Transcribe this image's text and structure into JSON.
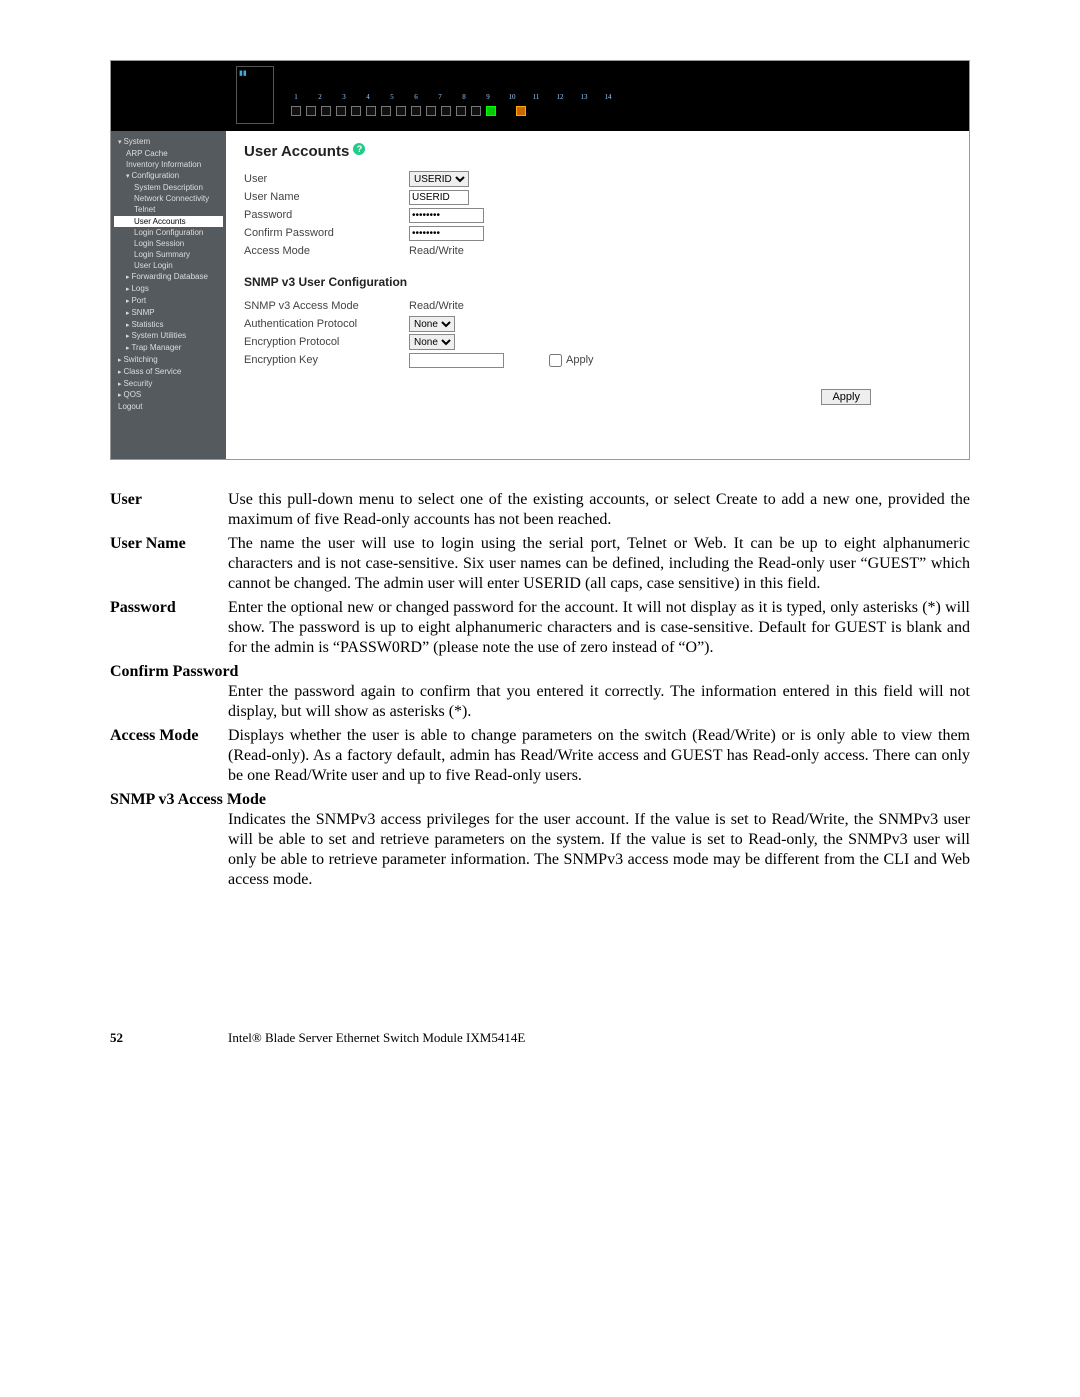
{
  "screenshot": {
    "port_numbers": [
      "1",
      "2",
      "3",
      "4",
      "5",
      "6",
      "7",
      "8",
      "9",
      "10",
      "11",
      "12",
      "13",
      "14"
    ],
    "sidebar": {
      "system": "System",
      "arp_cache": "ARP Cache",
      "inventory_info": "Inventory Information",
      "configuration": "Configuration",
      "system_description": "System Description",
      "network_connectivity": "Network Connectivity",
      "telnet": "Telnet",
      "user_accounts": "User Accounts",
      "login_configuration": "Login Configuration",
      "login_session": "Login Session",
      "login_summary": "Login Summary",
      "user_login": "User Login",
      "forwarding_database": "Forwarding Database",
      "logs": "Logs",
      "port": "Port",
      "snmp": "SNMP",
      "statistics": "Statistics",
      "system_utilities": "System Utilities",
      "trap_manager": "Trap Manager",
      "switching": "Switching",
      "cos": "Class of Service",
      "security": "Security",
      "qos": "QOS",
      "logout": "Logout"
    },
    "heading": "User Accounts",
    "labels": {
      "user": "User",
      "user_name": "User Name",
      "password": "Password",
      "confirm_password": "Confirm Password",
      "access_mode": "Access Mode",
      "snmp_heading": "SNMP v3 User Configuration",
      "snmp_access_mode": "SNMP v3 Access Mode",
      "auth_protocol": "Authentication Protocol",
      "encryption_protocol": "Encryption Protocol",
      "encryption_key": "Encryption Key"
    },
    "values": {
      "user_select": "USERID",
      "user_name": "USERID",
      "password": "••••••••",
      "confirm_password": "••••••••",
      "access_mode": "Read/Write",
      "snmp_access_mode": "Read/Write",
      "auth_protocol": "None",
      "encryption_protocol": "None",
      "encryption_key": "",
      "apply_checkbox": "Apply",
      "apply_button": "Apply"
    }
  },
  "definitions": {
    "user": {
      "term": "User",
      "desc": "Use this pull-down menu to select one of the existing accounts, or select Create to add a new one, provided the maximum of five Read-only accounts has not been reached."
    },
    "user_name": {
      "term": "User Name",
      "desc": "The name the user will use to login using the serial port, Telnet or Web. It can be up to eight alphanumeric characters and is not case-sensitive. Six user names can be defined, including the Read-only user “GUEST” which cannot be changed. The admin user will enter USERID (all caps, case sensitive) in this field."
    },
    "password": {
      "term": "Password",
      "desc": "Enter the optional new or changed password for the account. It will not display as it is typed, only asterisks (*) will show. The password is up to eight alphanumeric characters and is case-sensitive. Default for GUEST is blank and for the admin is “PASSW0RD” (please note the use of zero instead of “O”)."
    },
    "confirm_password": {
      "term": "Confirm Password",
      "desc": "Enter the password again to confirm that you entered it correctly. The information entered in this field will not display, but will show as asterisks (*)."
    },
    "access_mode": {
      "term": "Access Mode",
      "desc": "Displays whether the user is able to change parameters on the switch (Read/Write) or is only able to view them (Read-only). As a factory default, admin has Read/Write access and GUEST has Read-only access. There can only be one Read/Write user and up to five Read-only users."
    },
    "snmp_access_mode": {
      "term": "SNMP v3 Access Mode",
      "desc": "Indicates the SNMPv3 access privileges for the user account. If the value is set to Read/Write, the SNMPv3 user will be able to set and retrieve parameters on the system. If the value is set to Read-only, the SNMPv3 user will only be able to retrieve parameter information. The SNMPv3 access mode may be different from the CLI and Web access mode."
    }
  },
  "footer": {
    "page_number": "52",
    "title": "Intel® Blade Server Ethernet Switch Module IXM5414E"
  }
}
